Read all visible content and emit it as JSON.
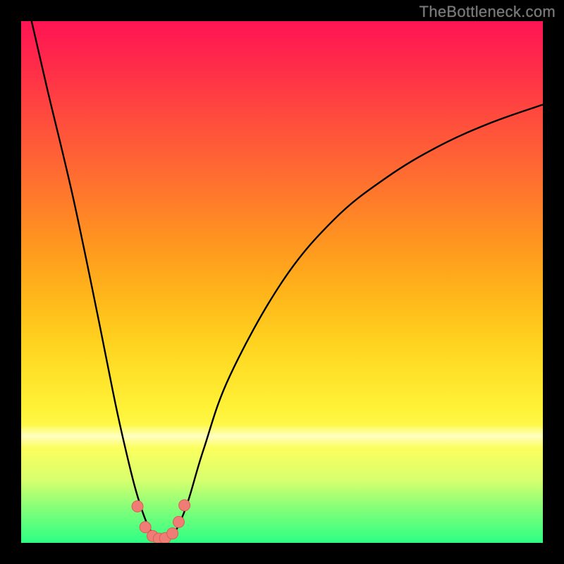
{
  "watermark": {
    "text": "TheBottleneck.com"
  },
  "colors": {
    "curve_stroke": "#000000",
    "marker_fill": "#ef7d75",
    "marker_stroke": "#d85f57"
  },
  "chart_data": {
    "type": "line",
    "title": "",
    "xlabel": "",
    "ylabel": "",
    "xlim": [
      0,
      100
    ],
    "ylim": [
      0,
      100
    ],
    "grid": false,
    "series": [
      {
        "name": "bottleneck-curve",
        "x": [
          2,
          5,
          10,
          15,
          18,
          20,
          22,
          24,
          25.5,
          27,
          28.5,
          30,
          32,
          35,
          40,
          50,
          60,
          70,
          80,
          90,
          100
        ],
        "y": [
          100,
          87,
          66,
          42,
          27,
          18,
          10,
          4,
          1.5,
          0.7,
          1.2,
          3,
          8,
          18,
          32,
          50,
          62,
          70,
          76,
          80.5,
          84
        ]
      }
    ],
    "markers": {
      "name": "bottom-cluster",
      "x": [
        22.3,
        23.8,
        25.2,
        26.4,
        27.6,
        29.0,
        30.2,
        31.3
      ],
      "y": [
        7.0,
        3.0,
        1.3,
        0.8,
        0.9,
        1.8,
        4.0,
        7.2
      ]
    }
  }
}
